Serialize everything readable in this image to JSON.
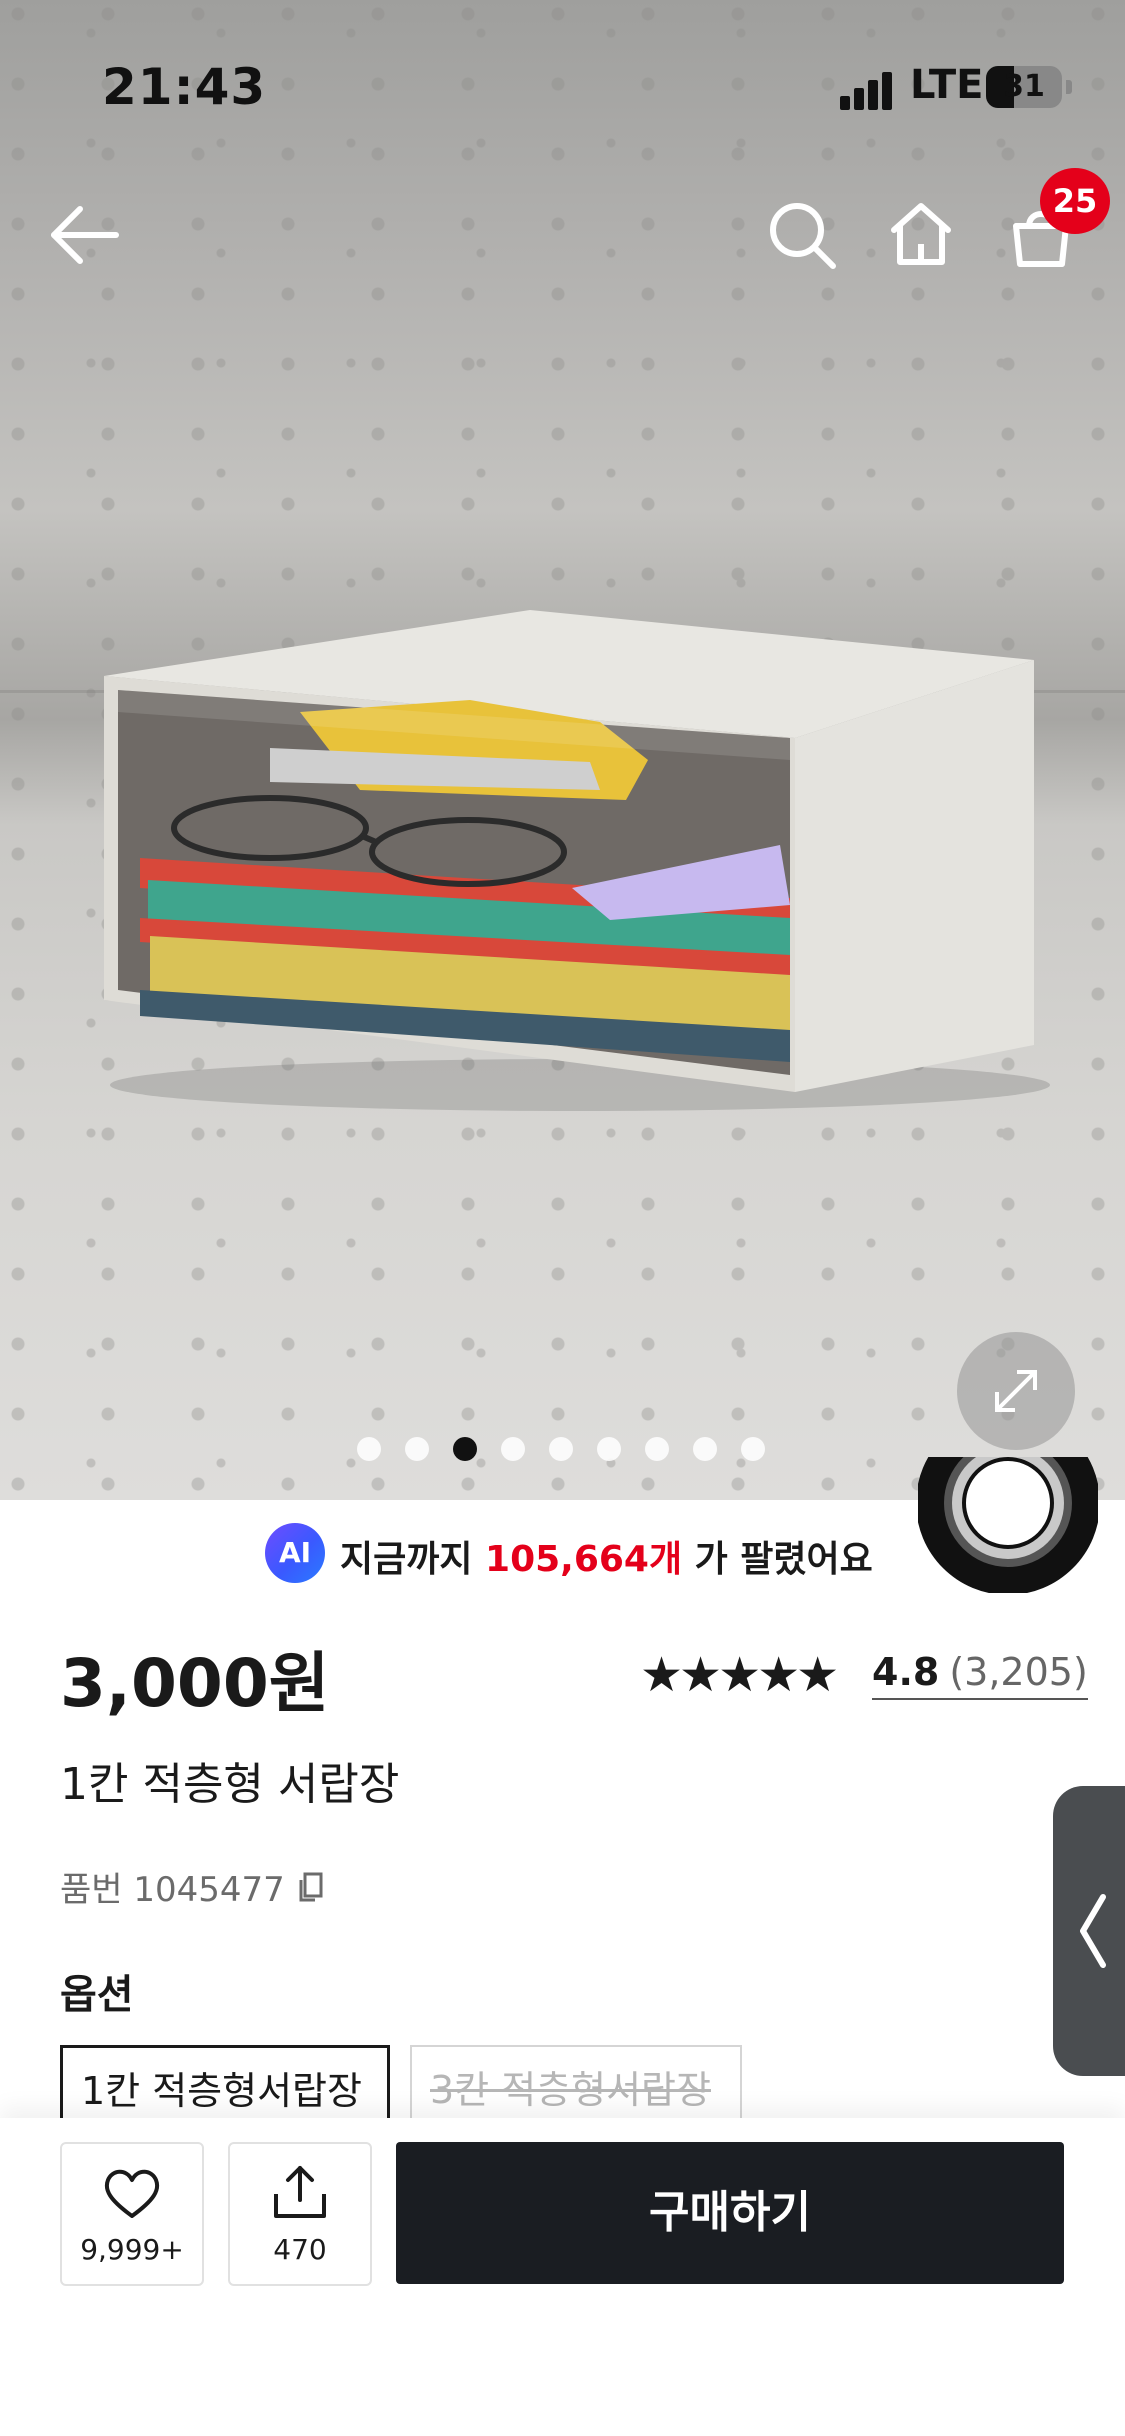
{
  "status_bar": {
    "time": "21:43",
    "network": "LTE",
    "battery": "31"
  },
  "header": {
    "cart_badge": "25",
    "icons": [
      "back-arrow-icon",
      "search-icon",
      "home-icon",
      "shopping-bag-icon"
    ]
  },
  "gallery": {
    "total_images": 9,
    "active_index": 2
  },
  "ai_banner": {
    "logo": "AI",
    "prefix": "지금까지 ",
    "count": "105,664개",
    "suffix": " 가 팔렸어요"
  },
  "product": {
    "price": "3,000원",
    "title": "1칸 적층형 서랍장",
    "sku_label": "품번 1045477",
    "rating_score": "4.8",
    "rating_count": "(3,205)",
    "stars": [
      "★",
      "★",
      "★",
      "★",
      "★"
    ],
    "star_value": 4.8
  },
  "options": {
    "title": "옵션",
    "items": [
      {
        "label": "1칸 적층형서랍장",
        "selected": true,
        "sold_out": false
      },
      {
        "label": "3칸 적층형서랍장",
        "selected": false,
        "sold_out": true
      }
    ]
  },
  "bottom_bar": {
    "like_count": "9,999+",
    "share_count": "470",
    "buy_label": "구매하기"
  },
  "colors": {
    "accent_red": "#e4001a",
    "dark_button": "#1a1d22",
    "ai_gradient_start": "#6f4cff",
    "ai_gradient_end": "#2a7bff"
  }
}
